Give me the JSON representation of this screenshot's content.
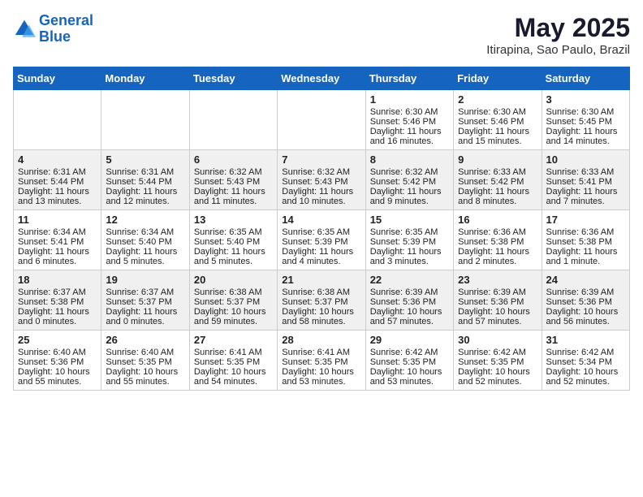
{
  "header": {
    "logo_line1": "General",
    "logo_line2": "Blue",
    "title": "May 2025",
    "subtitle": "Itirapina, Sao Paulo, Brazil"
  },
  "weekdays": [
    "Sunday",
    "Monday",
    "Tuesday",
    "Wednesday",
    "Thursday",
    "Friday",
    "Saturday"
  ],
  "rows": [
    [
      {
        "day": "",
        "lines": []
      },
      {
        "day": "",
        "lines": []
      },
      {
        "day": "",
        "lines": []
      },
      {
        "day": "",
        "lines": []
      },
      {
        "day": "1",
        "lines": [
          "Sunrise: 6:30 AM",
          "Sunset: 5:46 PM",
          "Daylight: 11 hours",
          "and 16 minutes."
        ]
      },
      {
        "day": "2",
        "lines": [
          "Sunrise: 6:30 AM",
          "Sunset: 5:46 PM",
          "Daylight: 11 hours",
          "and 15 minutes."
        ]
      },
      {
        "day": "3",
        "lines": [
          "Sunrise: 6:30 AM",
          "Sunset: 5:45 PM",
          "Daylight: 11 hours",
          "and 14 minutes."
        ]
      }
    ],
    [
      {
        "day": "4",
        "lines": [
          "Sunrise: 6:31 AM",
          "Sunset: 5:44 PM",
          "Daylight: 11 hours",
          "and 13 minutes."
        ]
      },
      {
        "day": "5",
        "lines": [
          "Sunrise: 6:31 AM",
          "Sunset: 5:44 PM",
          "Daylight: 11 hours",
          "and 12 minutes."
        ]
      },
      {
        "day": "6",
        "lines": [
          "Sunrise: 6:32 AM",
          "Sunset: 5:43 PM",
          "Daylight: 11 hours",
          "and 11 minutes."
        ]
      },
      {
        "day": "7",
        "lines": [
          "Sunrise: 6:32 AM",
          "Sunset: 5:43 PM",
          "Daylight: 11 hours",
          "and 10 minutes."
        ]
      },
      {
        "day": "8",
        "lines": [
          "Sunrise: 6:32 AM",
          "Sunset: 5:42 PM",
          "Daylight: 11 hours",
          "and 9 minutes."
        ]
      },
      {
        "day": "9",
        "lines": [
          "Sunrise: 6:33 AM",
          "Sunset: 5:42 PM",
          "Daylight: 11 hours",
          "and 8 minutes."
        ]
      },
      {
        "day": "10",
        "lines": [
          "Sunrise: 6:33 AM",
          "Sunset: 5:41 PM",
          "Daylight: 11 hours",
          "and 7 minutes."
        ]
      }
    ],
    [
      {
        "day": "11",
        "lines": [
          "Sunrise: 6:34 AM",
          "Sunset: 5:41 PM",
          "Daylight: 11 hours",
          "and 6 minutes."
        ]
      },
      {
        "day": "12",
        "lines": [
          "Sunrise: 6:34 AM",
          "Sunset: 5:40 PM",
          "Daylight: 11 hours",
          "and 5 minutes."
        ]
      },
      {
        "day": "13",
        "lines": [
          "Sunrise: 6:35 AM",
          "Sunset: 5:40 PM",
          "Daylight: 11 hours",
          "and 5 minutes."
        ]
      },
      {
        "day": "14",
        "lines": [
          "Sunrise: 6:35 AM",
          "Sunset: 5:39 PM",
          "Daylight: 11 hours",
          "and 4 minutes."
        ]
      },
      {
        "day": "15",
        "lines": [
          "Sunrise: 6:35 AM",
          "Sunset: 5:39 PM",
          "Daylight: 11 hours",
          "and 3 minutes."
        ]
      },
      {
        "day": "16",
        "lines": [
          "Sunrise: 6:36 AM",
          "Sunset: 5:38 PM",
          "Daylight: 11 hours",
          "and 2 minutes."
        ]
      },
      {
        "day": "17",
        "lines": [
          "Sunrise: 6:36 AM",
          "Sunset: 5:38 PM",
          "Daylight: 11 hours",
          "and 1 minute."
        ]
      }
    ],
    [
      {
        "day": "18",
        "lines": [
          "Sunrise: 6:37 AM",
          "Sunset: 5:38 PM",
          "Daylight: 11 hours",
          "and 0 minutes."
        ]
      },
      {
        "day": "19",
        "lines": [
          "Sunrise: 6:37 AM",
          "Sunset: 5:37 PM",
          "Daylight: 11 hours",
          "and 0 minutes."
        ]
      },
      {
        "day": "20",
        "lines": [
          "Sunrise: 6:38 AM",
          "Sunset: 5:37 PM",
          "Daylight: 10 hours",
          "and 59 minutes."
        ]
      },
      {
        "day": "21",
        "lines": [
          "Sunrise: 6:38 AM",
          "Sunset: 5:37 PM",
          "Daylight: 10 hours",
          "and 58 minutes."
        ]
      },
      {
        "day": "22",
        "lines": [
          "Sunrise: 6:39 AM",
          "Sunset: 5:36 PM",
          "Daylight: 10 hours",
          "and 57 minutes."
        ]
      },
      {
        "day": "23",
        "lines": [
          "Sunrise: 6:39 AM",
          "Sunset: 5:36 PM",
          "Daylight: 10 hours",
          "and 57 minutes."
        ]
      },
      {
        "day": "24",
        "lines": [
          "Sunrise: 6:39 AM",
          "Sunset: 5:36 PM",
          "Daylight: 10 hours",
          "and 56 minutes."
        ]
      }
    ],
    [
      {
        "day": "25",
        "lines": [
          "Sunrise: 6:40 AM",
          "Sunset: 5:36 PM",
          "Daylight: 10 hours",
          "and 55 minutes."
        ]
      },
      {
        "day": "26",
        "lines": [
          "Sunrise: 6:40 AM",
          "Sunset: 5:35 PM",
          "Daylight: 10 hours",
          "and 55 minutes."
        ]
      },
      {
        "day": "27",
        "lines": [
          "Sunrise: 6:41 AM",
          "Sunset: 5:35 PM",
          "Daylight: 10 hours",
          "and 54 minutes."
        ]
      },
      {
        "day": "28",
        "lines": [
          "Sunrise: 6:41 AM",
          "Sunset: 5:35 PM",
          "Daylight: 10 hours",
          "and 53 minutes."
        ]
      },
      {
        "day": "29",
        "lines": [
          "Sunrise: 6:42 AM",
          "Sunset: 5:35 PM",
          "Daylight: 10 hours",
          "and 53 minutes."
        ]
      },
      {
        "day": "30",
        "lines": [
          "Sunrise: 6:42 AM",
          "Sunset: 5:35 PM",
          "Daylight: 10 hours",
          "and 52 minutes."
        ]
      },
      {
        "day": "31",
        "lines": [
          "Sunrise: 6:42 AM",
          "Sunset: 5:34 PM",
          "Daylight: 10 hours",
          "and 52 minutes."
        ]
      }
    ]
  ]
}
